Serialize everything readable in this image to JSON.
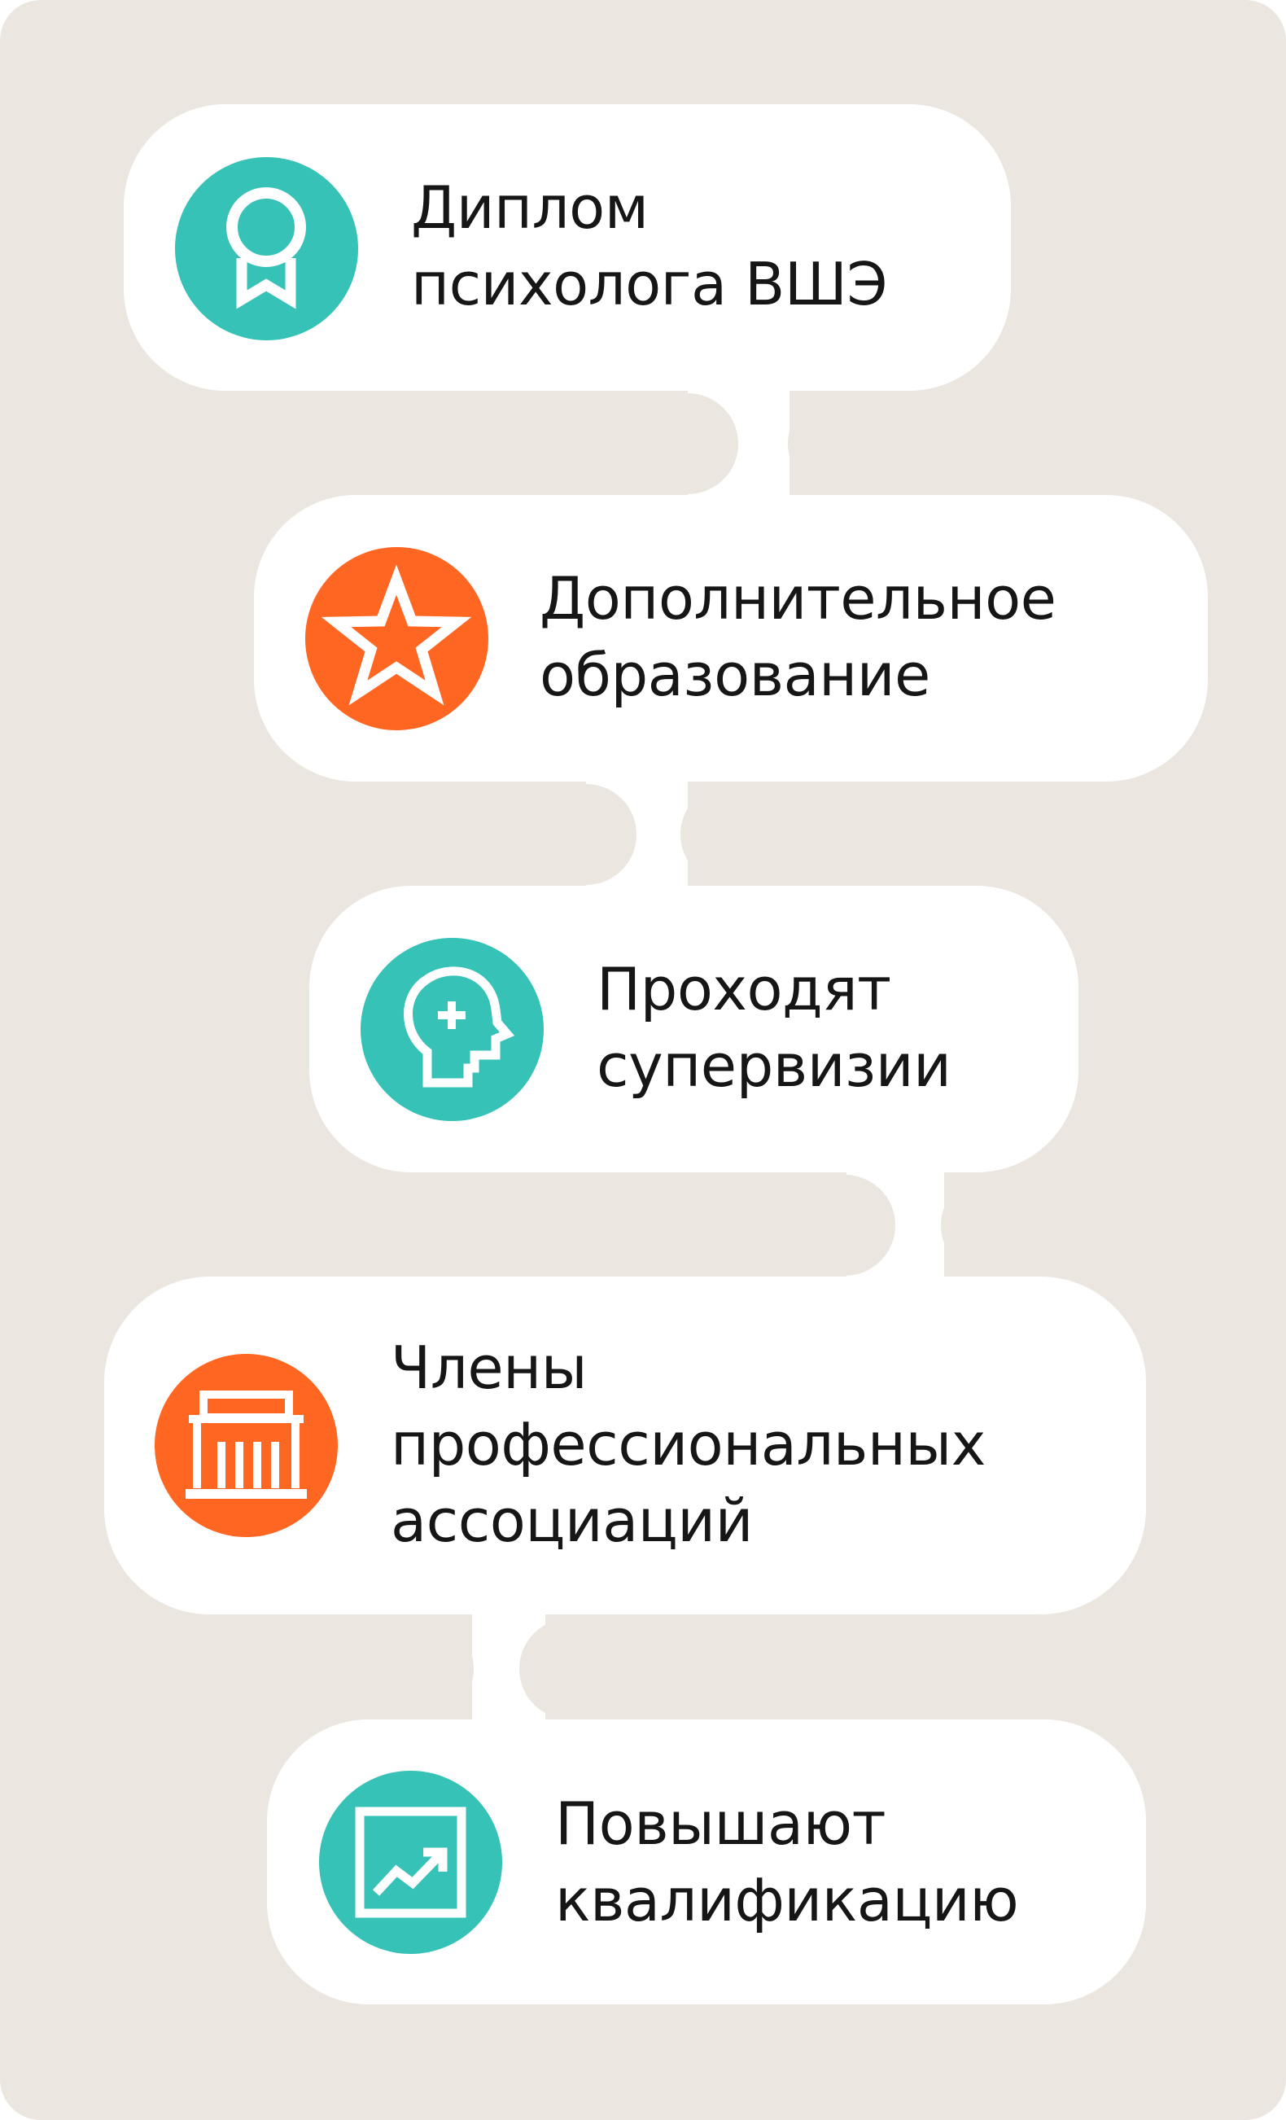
{
  "colors": {
    "background": "#ebe6e0",
    "card": "#ffffff",
    "teal": "#36c2b6",
    "orange": "#ff6622",
    "text": "#161616"
  },
  "steps": [
    {
      "icon": "ribbon-badge-icon",
      "color": "teal",
      "lines": [
        "Диплом",
        "психолога ВШЭ"
      ]
    },
    {
      "icon": "star-icon",
      "color": "orange",
      "lines": [
        "Дополнительное",
        "образование"
      ]
    },
    {
      "icon": "head-plus-icon",
      "color": "teal",
      "lines": [
        "Проходят",
        "супервизии"
      ]
    },
    {
      "icon": "building-icon",
      "color": "orange",
      "lines": [
        "Члены",
        "профессиональных",
        "ассоциаций"
      ]
    },
    {
      "icon": "growth-chart-icon",
      "color": "teal",
      "lines": [
        "Повышают",
        "квалификацию"
      ]
    }
  ]
}
